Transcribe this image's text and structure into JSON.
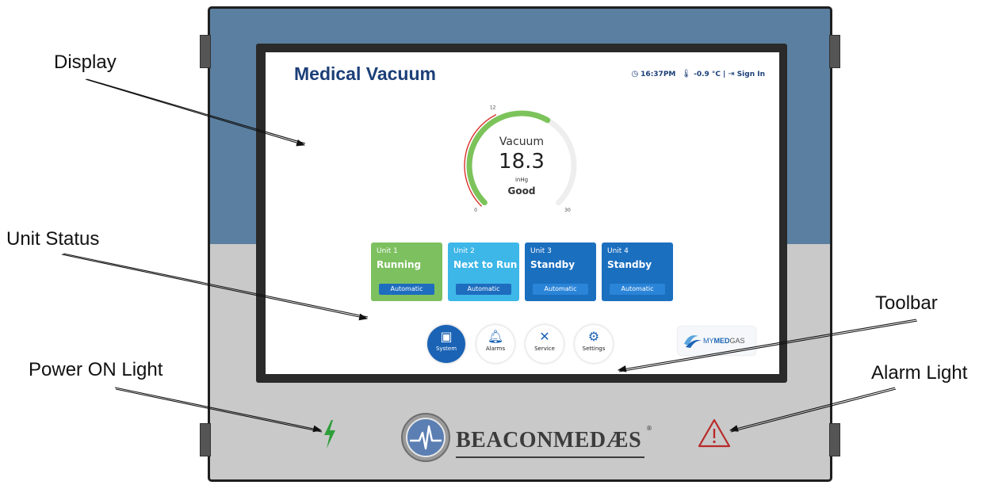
{
  "callouts": {
    "display": "Display",
    "unit_status": "Unit  Status",
    "toolbar": "Toolbar",
    "power_light": "Power ON Light",
    "alarm_light": "Alarm Light"
  },
  "screen": {
    "title": "Medical Vacuum",
    "status": {
      "time": "16:37PM",
      "temperature": "-0.9 °C",
      "separator": "|",
      "sign_in": "Sign In"
    }
  },
  "gauge": {
    "label": "Vacuum",
    "value": "18.3",
    "unit": "inHg",
    "state": "Good",
    "min_label": "0",
    "mid_label": "12",
    "max_label": "30",
    "value_num": 18.3,
    "min": 0,
    "max": 30,
    "threshold": 12,
    "colors": {
      "fill": "#7cc35a",
      "track": "#eeeeee",
      "warning": "#d9302a"
    }
  },
  "units": [
    {
      "name": "Unit 1",
      "state": "Running",
      "mode": "Automatic",
      "color": "#7dc060"
    },
    {
      "name": "Unit 2",
      "state": "Next to Run",
      "mode": "Automatic",
      "color": "#3db6e8"
    },
    {
      "name": "Unit 3",
      "state": "Standby",
      "mode": "Automatic",
      "color": "#1b6fbf"
    },
    {
      "name": "Unit 4",
      "state": "Standby",
      "mode": "Automatic",
      "color": "#1b6fbf"
    }
  ],
  "toolbar": [
    {
      "label": "System",
      "icon": "grid-icon",
      "active": true
    },
    {
      "label": "Alarms",
      "icon": "bell-icon",
      "active": false
    },
    {
      "label": "Service",
      "icon": "tools-icon",
      "active": false
    },
    {
      "label": "Settings",
      "icon": "gear-icon",
      "active": false
    }
  ],
  "partner_logo": {
    "text_my": "MY",
    "text_med": "MED",
    "text_gas": "GAS"
  },
  "brand": {
    "beacon": "BEACON",
    "medaes": "MEDÆS",
    "registered": "®"
  },
  "lights": {
    "power_color": "#2e9e3a",
    "alarm_color": "#b82a2a"
  }
}
